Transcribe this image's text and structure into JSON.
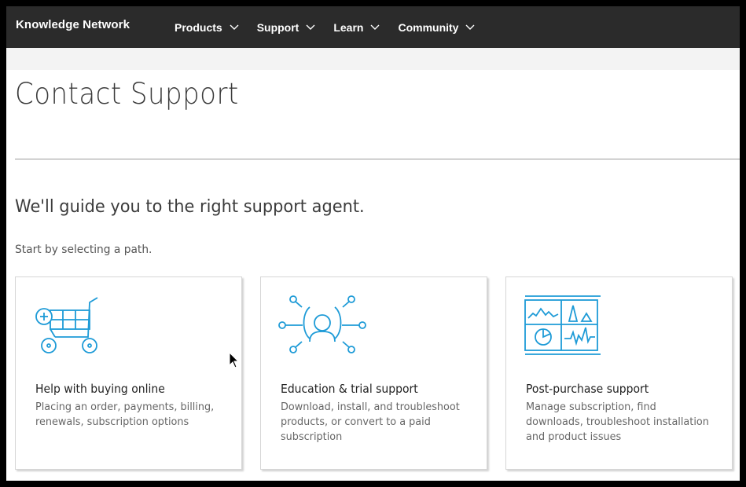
{
  "nav": {
    "brand": "Knowledge Network",
    "items": [
      {
        "label": "Products"
      },
      {
        "label": "Support"
      },
      {
        "label": "Learn"
      },
      {
        "label": "Community"
      }
    ]
  },
  "page": {
    "title": "Contact Support",
    "guide": "We'll guide you to the right support agent.",
    "start": "Start by selecting a path."
  },
  "cards": [
    {
      "icon": "shopping-cart-icon",
      "title": "Help with buying online",
      "description": "Placing an order, payments, billing, renewals, subscription options"
    },
    {
      "icon": "person-network-icon",
      "title": "Education & trial support",
      "description": "Download, install, and troubleshoot products, or convert to a paid subscription"
    },
    {
      "icon": "dashboard-icon",
      "title": "Post-purchase support",
      "description": "Manage subscription, find downloads, troubleshoot installation and product issues"
    }
  ],
  "colors": {
    "accent": "#1e9bd7",
    "nav_bg": "#2b2b2b"
  }
}
